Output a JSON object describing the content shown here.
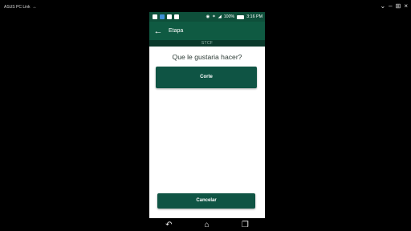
{
  "host": {
    "title": "ASUS PC Link",
    "controls": [
      "⌄",
      "–",
      "⊞",
      "×"
    ]
  },
  "statusbar": {
    "battery_percent": "100%",
    "time": "3:16 PM"
  },
  "toolbar": {
    "back_glyph": "←",
    "title": "Etapa"
  },
  "subbar": {
    "label": "STCF"
  },
  "main": {
    "question": "Que le gustaria hacer?",
    "corte_button": "Corte",
    "cancel_button": "Cancelar"
  },
  "navbar": {
    "back_glyph": "↶",
    "home_glyph": "⌂",
    "recent_glyph": "❐"
  },
  "colors": {
    "brand_dark": "#0b3a2c",
    "brand": "#0f5a42",
    "button": "#0f5444"
  }
}
